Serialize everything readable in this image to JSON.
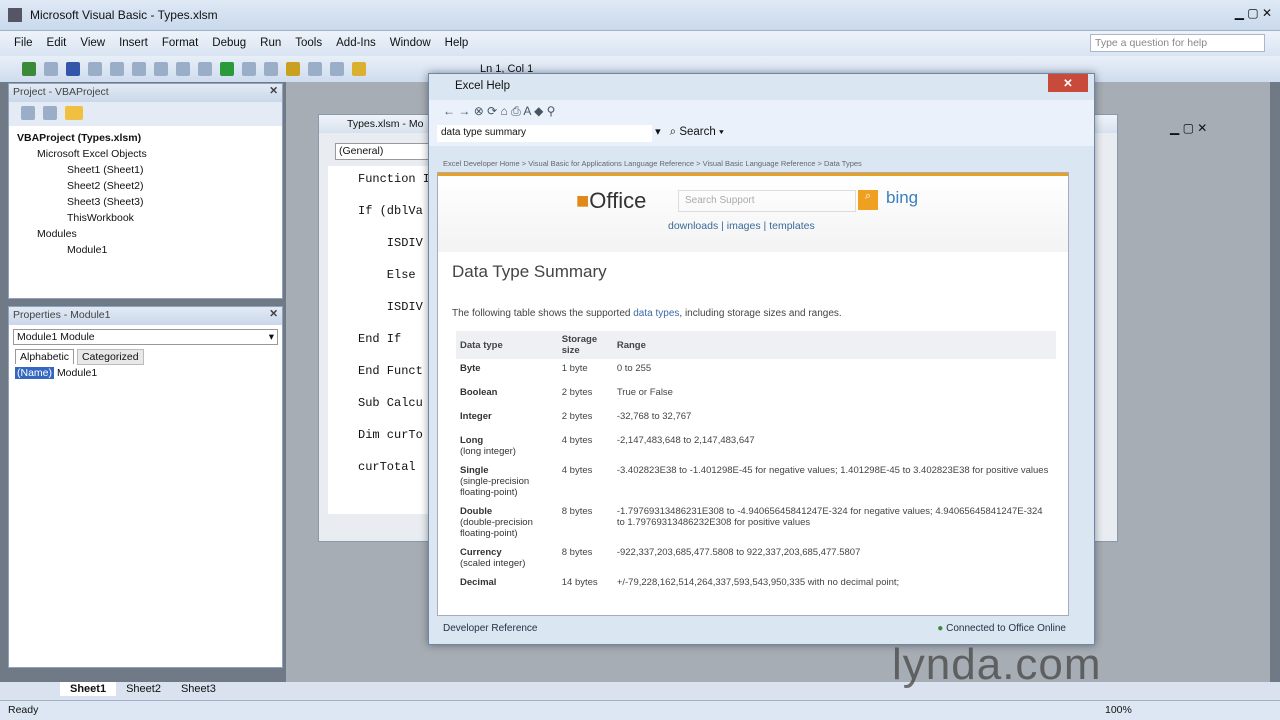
{
  "window": {
    "title": "Microsoft Visual Basic - Types.xlsm"
  },
  "menu": [
    "File",
    "Edit",
    "View",
    "Insert",
    "Format",
    "Debug",
    "Run",
    "Tools",
    "Add-Ins",
    "Window",
    "Help"
  ],
  "help_question_placeholder": "Type a question for help",
  "toolbar": {
    "position": "Ln 1, Col 1"
  },
  "project": {
    "title": "Project - VBAProject",
    "items": [
      "VBAProject (Types.xlsm)",
      "Microsoft Excel Objects",
      "Sheet1 (Sheet1)",
      "Sheet2 (Sheet2)",
      "Sheet3 (Sheet3)",
      "ThisWorkbook",
      "Modules",
      "Module1"
    ]
  },
  "properties": {
    "title": "Properties - Module1",
    "object": "Module1 Module",
    "tabs": [
      "Alphabetic",
      "Categorized"
    ],
    "prop_name": "(Name)",
    "prop_value": "Module1"
  },
  "code": {
    "title": "Types.xlsm - Mo",
    "object": "(General)",
    "lines": [
      "Function I",
      "If (dblVa",
      "    ISDIV",
      "    Else",
      "    ISDIV",
      "End If",
      "",
      "End Funct",
      "",
      "Sub Calcu",
      "Dim curTo",
      "curTotal"
    ]
  },
  "help": {
    "title": "Excel Help",
    "search_value": "data type summary",
    "search_label": "Search",
    "breadcrumb": "Excel Developer Home > Visual Basic for Applications Language Reference > Visual Basic Language Reference > Data Types",
    "office_logo": "Office",
    "search_support_placeholder": "Search Support",
    "bing": "bing",
    "links": [
      "downloads",
      "images",
      "templates"
    ],
    "heading": "Data Type Summary",
    "intro_before": "The following table shows the supported ",
    "intro_link": "data types",
    "intro_after": ", including storage sizes and ranges.",
    "columns": [
      "Data type",
      "Storage size",
      "Range"
    ],
    "rows": [
      {
        "type": "Byte",
        "sub": "",
        "size": "1 byte",
        "range": "0 to 255"
      },
      {
        "type": "Boolean",
        "sub": "",
        "size": "2 bytes",
        "range": "True or False"
      },
      {
        "type": "Integer",
        "sub": "",
        "size": "2 bytes",
        "range": "-32,768 to 32,767"
      },
      {
        "type": "Long",
        "sub": "(long integer)",
        "size": "4 bytes",
        "range": "-2,147,483,648 to 2,147,483,647"
      },
      {
        "type": "Single",
        "sub": "(single-precision floating-point)",
        "size": "4 bytes",
        "range": "-3.402823E38 to -1.401298E-45 for negative values; 1.401298E-45 to 3.402823E38 for positive values"
      },
      {
        "type": "Double",
        "sub": "(double-precision floating-point)",
        "size": "8 bytes",
        "range": "-1.79769313486231E308 to -4.94065645841247E-324 for negative values; 4.94065645841247E-324 to 1.79769313486232E308 for positive values"
      },
      {
        "type": "Currency",
        "sub": "(scaled integer)",
        "size": "8 bytes",
        "range": "-922,337,203,685,477.5808 to 922,337,203,685,477.5807"
      },
      {
        "type": "Decimal",
        "sub": "",
        "size": "14 bytes",
        "range": "+/-79,228,162,514,264,337,593,543,950,335 with no decimal point;"
      }
    ],
    "footer_left": "Developer Reference",
    "footer_right": "Connected to Office Online"
  },
  "sheets": [
    "Sheet1",
    "Sheet2",
    "Sheet3"
  ],
  "status": {
    "text": "Ready",
    "zoom": "100%"
  },
  "watermark": "lynda.com"
}
